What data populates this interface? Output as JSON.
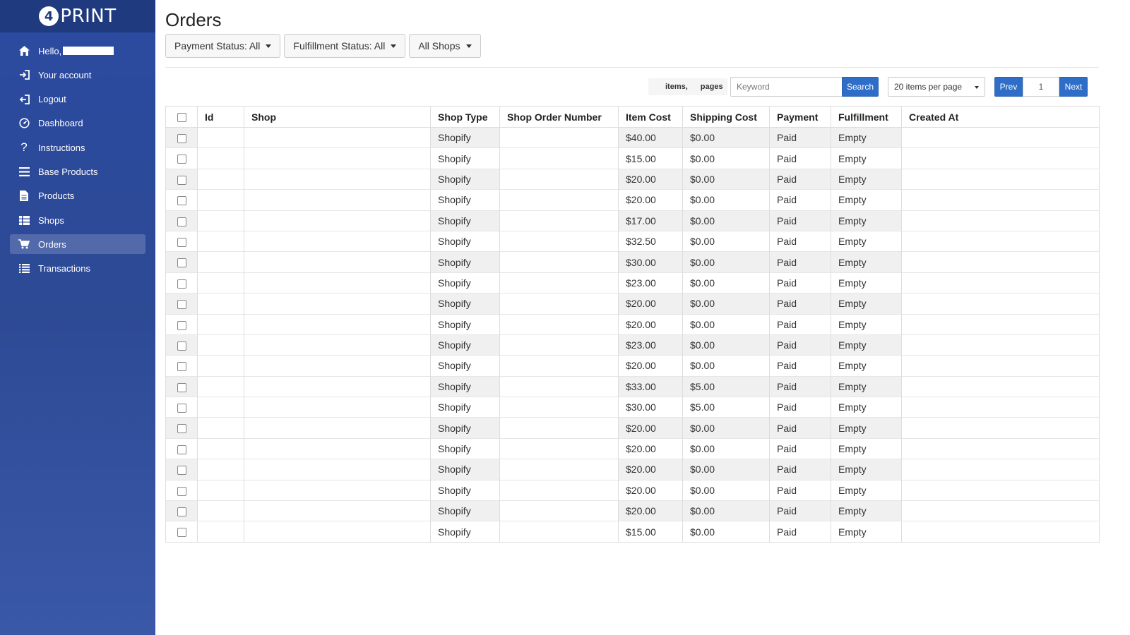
{
  "sidebar": {
    "logo_text": "PRINT",
    "logo_mark": "4",
    "items": [
      {
        "label": "Hello,",
        "icon": "home-icon"
      },
      {
        "label": "Your account",
        "icon": "sign-in-icon"
      },
      {
        "label": "Logout",
        "icon": "sign-out-icon"
      },
      {
        "label": "Dashboard",
        "icon": "dashboard-icon"
      },
      {
        "label": "Instructions",
        "icon": "question-icon"
      },
      {
        "label": "Base Products",
        "icon": "list-icon"
      },
      {
        "label": "Products",
        "icon": "file-icon"
      },
      {
        "label": "Shops",
        "icon": "grid-list-icon"
      },
      {
        "label": "Orders",
        "icon": "cart-icon",
        "active": true
      },
      {
        "label": "Transactions",
        "icon": "bullet-list-icon"
      }
    ]
  },
  "page": {
    "title": "Orders",
    "filters": {
      "payment": "Payment Status: All",
      "fulfillment": "Fulfillment Status: All",
      "shops": "All Shops"
    }
  },
  "toolbar": {
    "items_label": "items,",
    "pages_label": "pages",
    "search_placeholder": "Keyword",
    "search_label": "Search",
    "per_page": "20 items per page",
    "prev_label": "Prev",
    "page_value": "1",
    "next_label": "Next"
  },
  "table": {
    "headers": {
      "id": "Id",
      "shop": "Shop",
      "shop_type": "Shop Type",
      "shop_order_number": "Shop Order Number",
      "item_cost": "Item Cost",
      "shipping_cost": "Shipping Cost",
      "payment": "Payment",
      "fulfillment": "Fulfillment",
      "created_at": "Created At"
    },
    "rows": [
      {
        "shop_type": "Shopify",
        "item_cost": "$40.00",
        "shipping_cost": "$0.00",
        "payment": "Paid",
        "fulfillment": "Empty"
      },
      {
        "shop_type": "Shopify",
        "item_cost": "$15.00",
        "shipping_cost": "$0.00",
        "payment": "Paid",
        "fulfillment": "Empty"
      },
      {
        "shop_type": "Shopify",
        "item_cost": "$20.00",
        "shipping_cost": "$0.00",
        "payment": "Paid",
        "fulfillment": "Empty"
      },
      {
        "shop_type": "Shopify",
        "item_cost": "$20.00",
        "shipping_cost": "$0.00",
        "payment": "Paid",
        "fulfillment": "Empty"
      },
      {
        "shop_type": "Shopify",
        "item_cost": "$17.00",
        "shipping_cost": "$0.00",
        "payment": "Paid",
        "fulfillment": "Empty"
      },
      {
        "shop_type": "Shopify",
        "item_cost": "$32.50",
        "shipping_cost": "$0.00",
        "payment": "Paid",
        "fulfillment": "Empty"
      },
      {
        "shop_type": "Shopify",
        "item_cost": "$30.00",
        "shipping_cost": "$0.00",
        "payment": "Paid",
        "fulfillment": "Empty"
      },
      {
        "shop_type": "Shopify",
        "item_cost": "$23.00",
        "shipping_cost": "$0.00",
        "payment": "Paid",
        "fulfillment": "Empty"
      },
      {
        "shop_type": "Shopify",
        "item_cost": "$20.00",
        "shipping_cost": "$0.00",
        "payment": "Paid",
        "fulfillment": "Empty"
      },
      {
        "shop_type": "Shopify",
        "item_cost": "$20.00",
        "shipping_cost": "$0.00",
        "payment": "Paid",
        "fulfillment": "Empty"
      },
      {
        "shop_type": "Shopify",
        "item_cost": "$23.00",
        "shipping_cost": "$0.00",
        "payment": "Paid",
        "fulfillment": "Empty"
      },
      {
        "shop_type": "Shopify",
        "item_cost": "$20.00",
        "shipping_cost": "$0.00",
        "payment": "Paid",
        "fulfillment": "Empty"
      },
      {
        "shop_type": "Shopify",
        "item_cost": "$33.00",
        "shipping_cost": "$5.00",
        "payment": "Paid",
        "fulfillment": "Empty"
      },
      {
        "shop_type": "Shopify",
        "item_cost": "$30.00",
        "shipping_cost": "$5.00",
        "payment": "Paid",
        "fulfillment": "Empty"
      },
      {
        "shop_type": "Shopify",
        "item_cost": "$20.00",
        "shipping_cost": "$0.00",
        "payment": "Paid",
        "fulfillment": "Empty"
      },
      {
        "shop_type": "Shopify",
        "item_cost": "$20.00",
        "shipping_cost": "$0.00",
        "payment": "Paid",
        "fulfillment": "Empty"
      },
      {
        "shop_type": "Shopify",
        "item_cost": "$20.00",
        "shipping_cost": "$0.00",
        "payment": "Paid",
        "fulfillment": "Empty"
      },
      {
        "shop_type": "Shopify",
        "item_cost": "$20.00",
        "shipping_cost": "$0.00",
        "payment": "Paid",
        "fulfillment": "Empty"
      },
      {
        "shop_type": "Shopify",
        "item_cost": "$20.00",
        "shipping_cost": "$0.00",
        "payment": "Paid",
        "fulfillment": "Empty"
      },
      {
        "shop_type": "Shopify",
        "item_cost": "$15.00",
        "shipping_cost": "$0.00",
        "payment": "Paid",
        "fulfillment": "Empty"
      }
    ]
  },
  "colors": {
    "sidebar": "#2d4a95",
    "primary": "#2f6ec8"
  }
}
